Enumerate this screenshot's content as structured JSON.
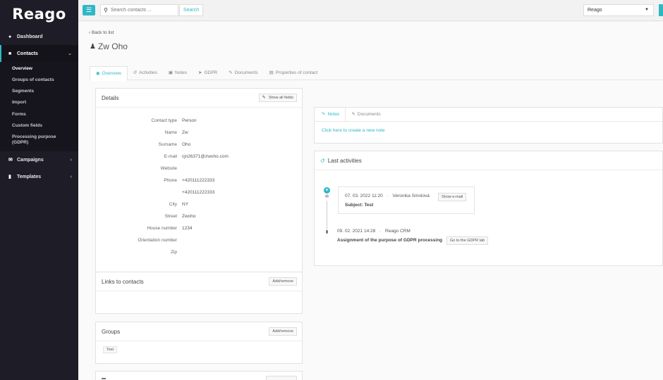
{
  "app": {
    "logo": "Reago"
  },
  "sidebar": {
    "items": [
      {
        "label": "Dashboard",
        "icon": "tachometer-icon"
      },
      {
        "label": "Contacts",
        "icon": "contacts-icon"
      },
      {
        "label": "Campaigns",
        "icon": "envelope-icon"
      },
      {
        "label": "Templates",
        "icon": "file-icon"
      }
    ],
    "contacts_sub": [
      {
        "label": "Overview"
      },
      {
        "label": "Groups of contacts"
      },
      {
        "label": "Segments"
      },
      {
        "label": "Import"
      },
      {
        "label": "Forms"
      },
      {
        "label": "Custom fields"
      },
      {
        "label": "Processing purpose (GDPR)"
      }
    ]
  },
  "topbar": {
    "search_placeholder": "Search contacts ...",
    "search_button": "Search",
    "account": "Reago"
  },
  "page": {
    "back": "Back to list",
    "title": "Zw Oho"
  },
  "tabs": [
    {
      "label": "Overview"
    },
    {
      "label": "Activities"
    },
    {
      "label": "Notes"
    },
    {
      "label": "GDPR"
    },
    {
      "label": "Documents"
    },
    {
      "label": "Properties of contact"
    }
  ],
  "details": {
    "title": "Details",
    "show_all": "Show all fields",
    "fields": [
      {
        "label": "Contact type",
        "value": "Person"
      },
      {
        "label": "Name",
        "value": "Zw"
      },
      {
        "label": "Surname",
        "value": "Oho"
      },
      {
        "label": "E-mail",
        "value": "cjn26371@zwoho.com"
      },
      {
        "label": "Website",
        "value": ""
      },
      {
        "label": "Phone",
        "value": "+420111222333"
      },
      {
        "label": "",
        "value": "+420111222333"
      },
      {
        "label": "City",
        "value": "NY"
      },
      {
        "label": "Street",
        "value": "Zwoho"
      },
      {
        "label": "House number",
        "value": "1234"
      },
      {
        "label": "Orientation number",
        "value": ""
      },
      {
        "label": "Zip",
        "value": ""
      }
    ]
  },
  "links": {
    "title": "Links to contacts",
    "button": "Add/remove"
  },
  "groups": {
    "title": "Groups",
    "button": "Add/remove",
    "tags": [
      "Test"
    ]
  },
  "notes_panel": {
    "tabs": [
      {
        "label": "Notes"
      },
      {
        "label": "Documents"
      }
    ],
    "create_link": "Click here to create a new note"
  },
  "activities": {
    "title": "Last activities",
    "items": [
      {
        "date": "07. 03. 2022 11:20",
        "author": "Veronika Smolová",
        "button": "Show e-mail",
        "subject": "Subject: Test"
      },
      {
        "date": "09. 02. 2021 14:28",
        "author": "Reago CRM",
        "text": "Assignment of the purpose of GDPR processing",
        "button": "Go to the GDPR tab"
      }
    ]
  },
  "colors": {
    "accent": "#30b7c5",
    "sidebar": "#1e1c26"
  }
}
